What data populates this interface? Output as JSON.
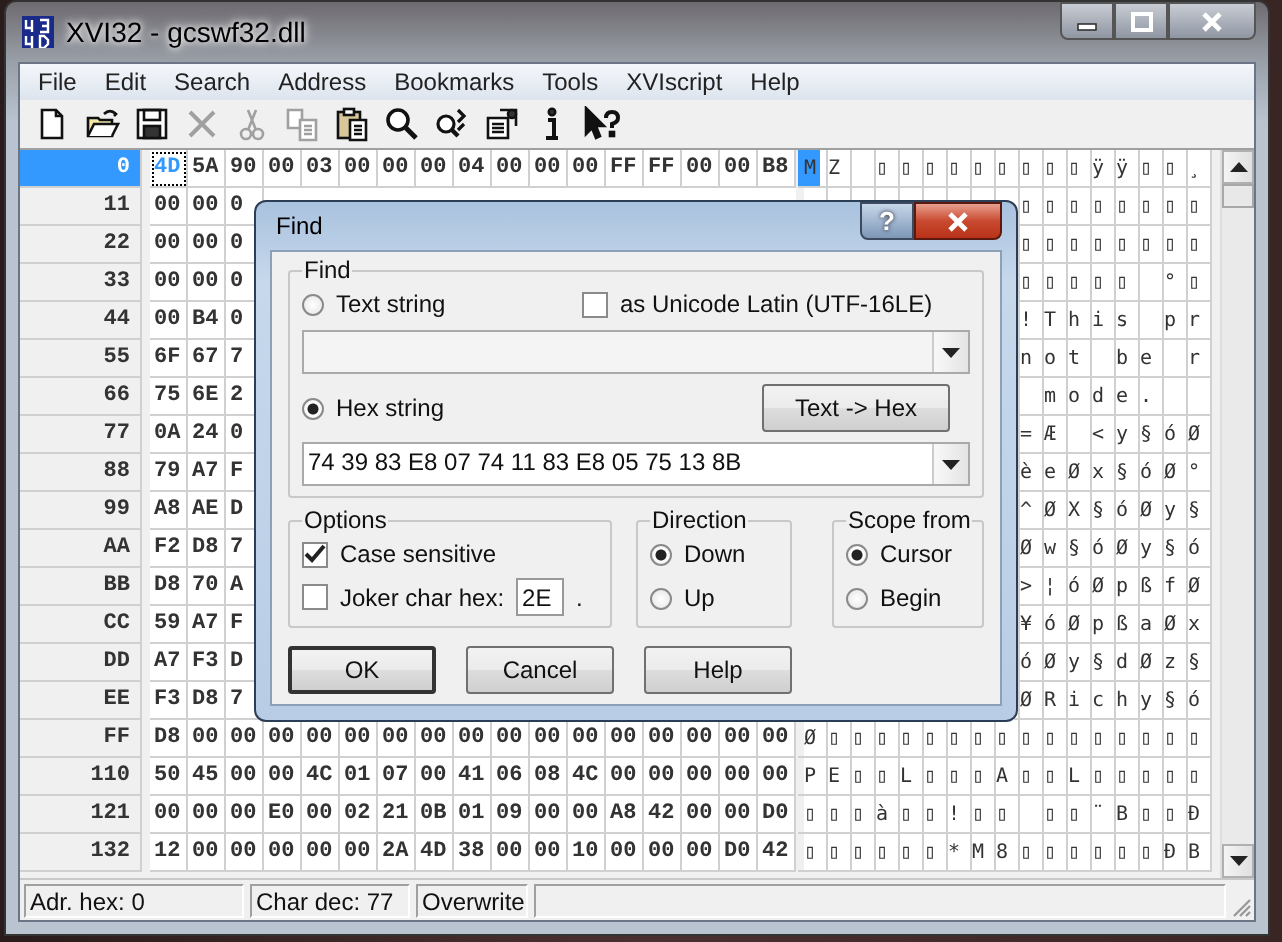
{
  "window": {
    "title": "XVI32 - gcswf32.dll"
  },
  "menu": [
    "File",
    "Edit",
    "Search",
    "Address",
    "Bookmarks",
    "Tools",
    "XVIscript",
    "Help"
  ],
  "toolbar": [
    {
      "kind": "new",
      "disabled": false
    },
    {
      "kind": "open",
      "disabled": false
    },
    {
      "kind": "save",
      "disabled": false
    },
    {
      "kind": "delete",
      "disabled": true
    },
    {
      "kind": "cut",
      "disabled": true
    },
    {
      "kind": "copy",
      "disabled": true
    },
    {
      "kind": "paste",
      "disabled": false
    },
    {
      "kind": "find",
      "disabled": false
    },
    {
      "kind": "find-next",
      "disabled": false
    },
    {
      "kind": "settings",
      "disabled": false
    },
    {
      "kind": "info",
      "disabled": false
    },
    {
      "kind": "context-help",
      "disabled": false
    }
  ],
  "grid": {
    "rows": [
      {
        "address": "0",
        "selected": true,
        "hex": [
          "4D",
          "5A",
          "90",
          "00",
          "03",
          "00",
          "00",
          "00",
          "04",
          "00",
          "00",
          "00",
          "FF",
          "FF",
          "00",
          "00",
          "B8"
        ],
        "chars": "MZ ▯▯▯▯▯▯▯▯▯ÿÿ▯▯¸"
      },
      {
        "address": "11",
        "selected": false,
        "hex": [
          "00",
          "00",
          "0"
        ],
        "chars": "▯▯▯▯▯▯▯▯"
      },
      {
        "address": "22",
        "selected": false,
        "hex": [
          "00",
          "00",
          "0"
        ],
        "chars": "▯▯▯▯▯▯▯▯"
      },
      {
        "address": "33",
        "selected": false,
        "hex": [
          "00",
          "00",
          "0"
        ],
        "chars": "▯▯▯▯▯ °▯"
      },
      {
        "address": "44",
        "selected": false,
        "hex": [
          "00",
          "B4",
          "0"
        ],
        "chars": "!This pr"
      },
      {
        "address": "55",
        "selected": false,
        "hex": [
          "6F",
          "67",
          "7"
        ],
        "chars": "not be r"
      },
      {
        "address": "66",
        "selected": false,
        "hex": [
          "75",
          "6E",
          "2"
        ],
        "chars": " mode.  "
      },
      {
        "address": "77",
        "selected": false,
        "hex": [
          "0A",
          "24",
          "0"
        ],
        "chars": "=Æ <y§óØ"
      },
      {
        "address": "88",
        "selected": false,
        "hex": [
          "79",
          "A7",
          "F"
        ],
        "chars": "èeØx§óØ°"
      },
      {
        "address": "99",
        "selected": false,
        "hex": [
          "A8",
          "AE",
          "D"
        ],
        "chars": "^ØX§óØy§"
      },
      {
        "address": "AA",
        "selected": false,
        "hex": [
          "F2",
          "D8",
          "7"
        ],
        "chars": "Øw§óØy§ó"
      },
      {
        "address": "BB",
        "selected": false,
        "hex": [
          "D8",
          "70",
          "A"
        ],
        "chars": ">¦óØpßfØ"
      },
      {
        "address": "CC",
        "selected": false,
        "hex": [
          "59",
          "A7",
          "F"
        ],
        "chars": "¥óØpßaØx"
      },
      {
        "address": "DD",
        "selected": false,
        "hex": [
          "A7",
          "F3",
          "D"
        ],
        "chars": "óØy§dØz§"
      },
      {
        "address": "EE",
        "selected": false,
        "hex": [
          "F3",
          "D8",
          "7"
        ],
        "chars": "ØRichy§ó"
      },
      {
        "address": "FF",
        "selected": false,
        "hex": [
          "D8",
          "00",
          "00",
          "00",
          "00",
          "00",
          "00",
          "00",
          "00",
          "00",
          "00",
          "00",
          "00",
          "00",
          "00",
          "00",
          "00"
        ],
        "chars": "Ø▯▯▯▯▯▯▯▯▯▯▯▯▯▯▯▯"
      },
      {
        "address": "110",
        "selected": false,
        "hex": [
          "50",
          "45",
          "00",
          "00",
          "4C",
          "01",
          "07",
          "00",
          "41",
          "06",
          "08",
          "4C",
          "00",
          "00",
          "00",
          "00",
          "00"
        ],
        "chars": "PE▯▯L▯▯▯A▯▯L▯▯▯▯▯"
      },
      {
        "address": "121",
        "selected": false,
        "hex": [
          "00",
          "00",
          "00",
          "E0",
          "00",
          "02",
          "21",
          "0B",
          "01",
          "09",
          "00",
          "00",
          "A8",
          "42",
          "00",
          "00",
          "D0"
        ],
        "chars": "▯▯▯à▯▯!▯▯ ▯▯¨B▯▯Ð"
      },
      {
        "address": "132",
        "selected": false,
        "hex": [
          "12",
          "00",
          "00",
          "00",
          "00",
          "00",
          "2A",
          "4D",
          "38",
          "00",
          "00",
          "10",
          "00",
          "00",
          "00",
          "D0",
          "42"
        ],
        "chars": "▯▯▯▯▯▯*M8▯▯▯▯▯▯ÐB"
      }
    ]
  },
  "status_bar": [
    "Adr. hex: 0",
    "Char dec: 77",
    "Overwrite"
  ],
  "find_dialog": {
    "title": "Find",
    "help_button": "?",
    "find_group": {
      "legend": "Find",
      "text_option": {
        "label": "Text string",
        "selected": false
      },
      "unicode_option": {
        "label": "as Unicode Latin (UTF-16LE)",
        "checked": false
      },
      "hex_option": {
        "label": "Hex string",
        "selected": true
      },
      "convert_button": "Text -> Hex",
      "hex_field": {
        "value": "74 39 83 E8 07 74 11 83 E8 05 75 13 8B"
      }
    },
    "options": {
      "legend": "Options",
      "case_sensitive": {
        "label": "Case sensitive",
        "checked": true
      },
      "joker": {
        "label": "Joker char hex:",
        "checked": false,
        "value": "2E",
        "suffix": "."
      }
    },
    "direction": {
      "legend": "Direction",
      "choices": [
        {
          "label": "Down",
          "selected": true
        },
        {
          "label": "Up",
          "selected": false
        }
      ]
    },
    "scope": {
      "legend": "Scope from",
      "choices": [
        {
          "label": "Cursor",
          "selected": true
        },
        {
          "label": "Begin",
          "selected": false
        }
      ]
    },
    "buttons": [
      {
        "label": "OK",
        "default": true
      },
      {
        "label": "Cancel",
        "default": false
      },
      {
        "label": "Help",
        "default": false
      }
    ]
  }
}
